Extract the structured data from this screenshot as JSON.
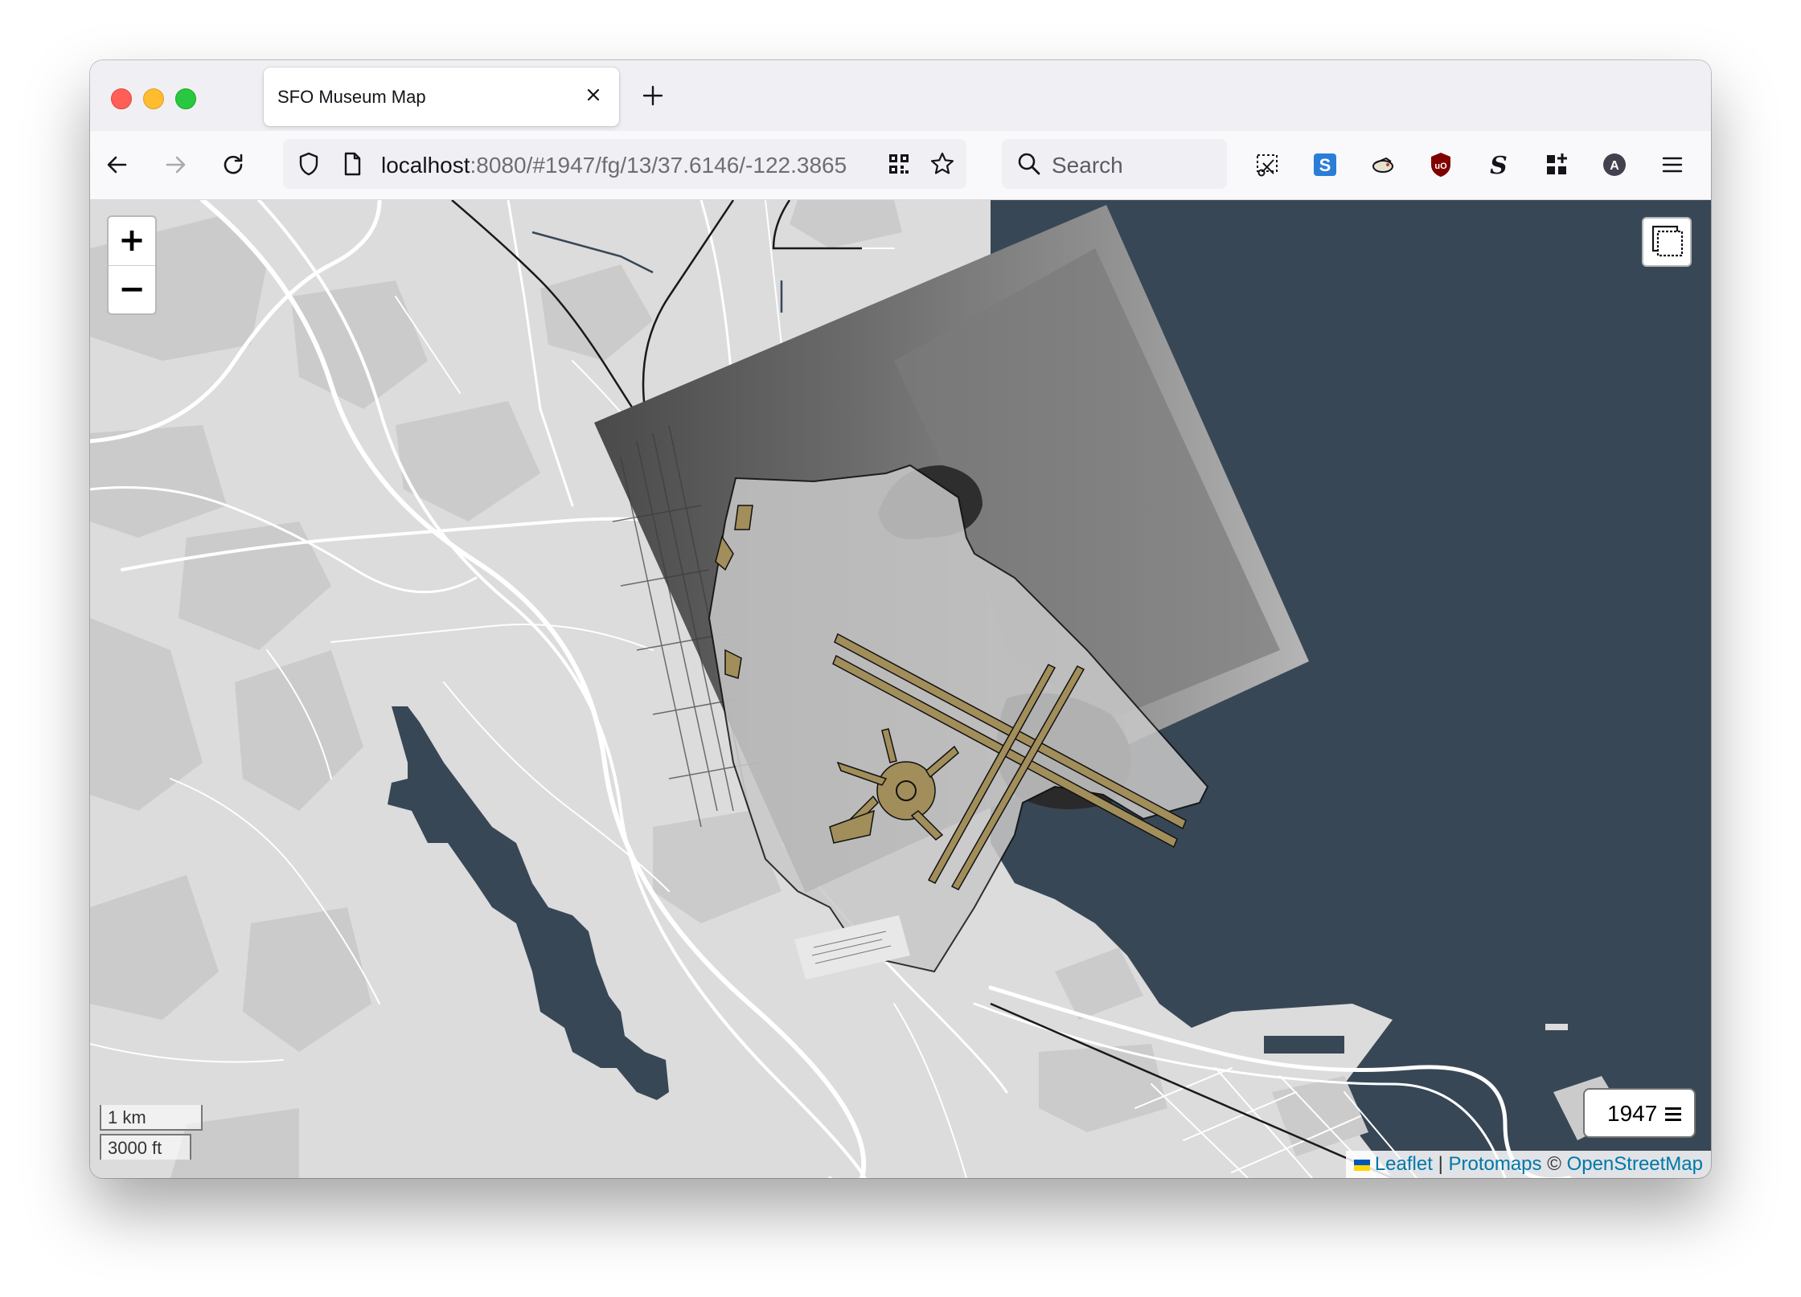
{
  "browser": {
    "tab_title": "SFO Museum Map",
    "url_host": "localhost",
    "url_rest": ":8080/#1947/fg/13/37.6146/-122.3865",
    "search_placeholder": "Search"
  },
  "map": {
    "zoom_in_label": "+",
    "zoom_out_label": "−",
    "year": "1947",
    "scale_metric": "1 km",
    "scale_imperial": "3000 ft",
    "attribution": {
      "leaflet": "Leaflet",
      "separator": "|",
      "protomaps": "Protomaps",
      "copyright": "©",
      "osm": "OpenStreetMap"
    },
    "colors": {
      "water": "#384756",
      "land": "#dcdcdc",
      "landuse": "#cccccc",
      "runway_fill": "#a28e5a",
      "link": "#0078a8"
    }
  },
  "icons": {
    "back": "back-arrow-icon",
    "forward": "forward-arrow-icon",
    "reload": "reload-icon",
    "shield": "shield-icon",
    "page": "page-icon",
    "qr": "qr-code-icon",
    "bookmark": "star-icon",
    "search": "search-icon",
    "layers": "layers-icon",
    "menu": "hamburger-menu-icon"
  }
}
